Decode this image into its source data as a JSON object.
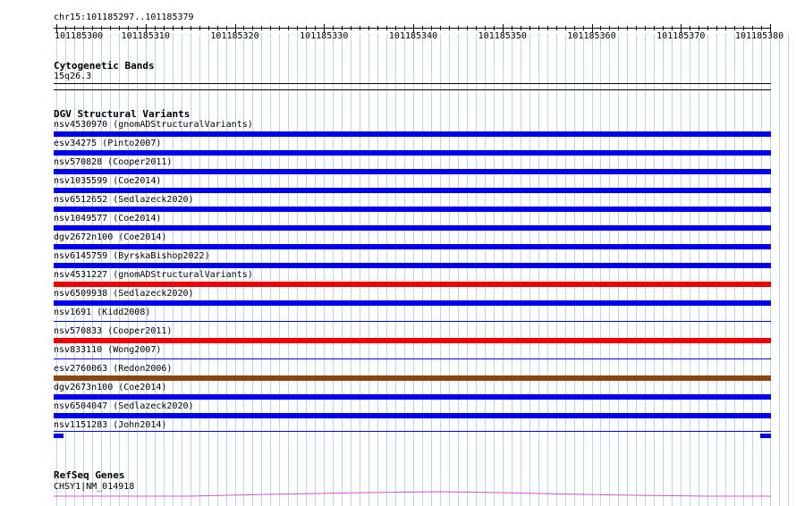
{
  "colors": {
    "grid": "#b3d9ec",
    "loss": "#0000ee",
    "gain": "#ee0000",
    "complex": "#8b4513",
    "gene_line": "#cc55cc"
  },
  "ruler": {
    "location": "chr15:101185297..101185379",
    "ticks": [
      "101185300",
      "101185310",
      "101185320",
      "101185330",
      "101185340",
      "101185350",
      "101185360",
      "101185370",
      "101185380"
    ]
  },
  "cytoband": {
    "title": "Cytogenetic Bands",
    "band": "15q26.3"
  },
  "dgv": {
    "title": "DGV Structural Variants",
    "features": [
      {
        "label": "nsv4530970 (gnomADStructuralVariants)",
        "type": "loss",
        "color": "#0000ee"
      },
      {
        "label": "esv34275 (Pinto2007)",
        "type": "loss",
        "color": "#0000ee"
      },
      {
        "label": "nsv570828 (Cooper2011)",
        "type": "loss",
        "color": "#0000ee"
      },
      {
        "label": "nsv1035599 (Coe2014)",
        "type": "loss",
        "color": "#0000ee"
      },
      {
        "label": "nsv6512652 (Sedlazeck2020)",
        "type": "loss",
        "color": "#0000ee"
      },
      {
        "label": "nsv1049577 (Coe2014)",
        "type": "loss",
        "color": "#0000ee"
      },
      {
        "label": "dgv2672n100 (Coe2014)",
        "type": "loss",
        "color": "#0000ee"
      },
      {
        "label": "nsv6145759 (ByrskaBishop2022)",
        "type": "loss",
        "color": "#0000ee"
      },
      {
        "label": "nsv4531227 (gnomADStructuralVariants)",
        "type": "gain",
        "color": "#ee0000"
      },
      {
        "label": "nsv6509938 (Sedlazeck2020)",
        "type": "loss",
        "color": "#0000ee"
      },
      {
        "label": "nsv1691 (Kidd2008)",
        "type": "line",
        "color": "#0000ee"
      },
      {
        "label": "nsv570833 (Cooper2011)",
        "type": "gain",
        "color": "#ee0000"
      },
      {
        "label": "nsv833110 (Wong2007)",
        "type": "line",
        "color": "#0000ee"
      },
      {
        "label": "esv2760063 (Redon2006)",
        "type": "complex",
        "color": "#8b4513"
      },
      {
        "label": "dgv2673n100 (Coe2014)",
        "type": "loss",
        "color": "#0000ee"
      },
      {
        "label": "nsv6504047 (Sedlazeck2020)",
        "type": "loss",
        "color": "#0000ee"
      },
      {
        "label": "nsv1151283 (John2014)",
        "type": "split",
        "color": "#0000ee"
      }
    ]
  },
  "refseq": {
    "title": "RefSeq Genes",
    "gene": "CHSY1|NM_014918"
  }
}
